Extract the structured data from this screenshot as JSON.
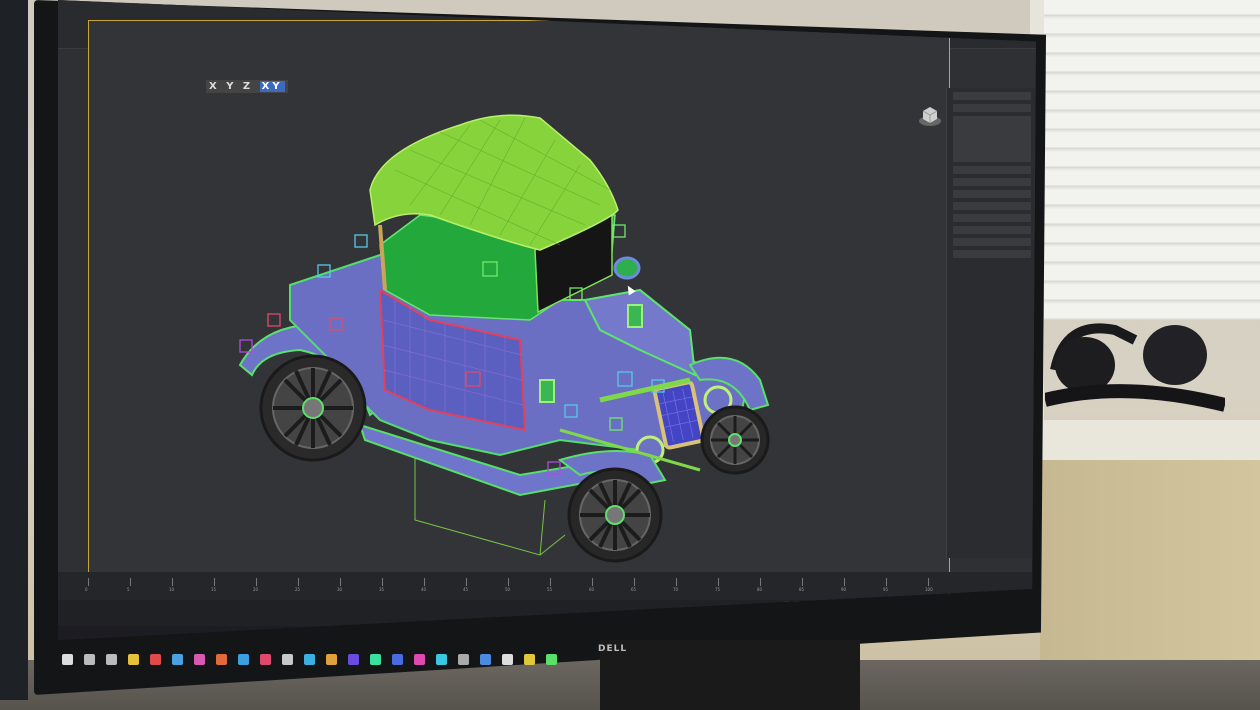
{
  "scene": {
    "description_colors": {
      "roof": "#8cd43a",
      "body": "#6b6fc4",
      "interior": "#1fae3c",
      "wire_green": "#4df06a",
      "wire_red": "#e0405a",
      "tire": "#2a2a2a"
    }
  },
  "viewport": {
    "axis_labels": "X Y Z",
    "axis_highlight": "XY"
  },
  "monitor": {
    "brand": "DELL"
  },
  "timeline": {
    "ticks": [
      "0",
      "5",
      "10",
      "15",
      "20",
      "25",
      "30",
      "35",
      "40",
      "45",
      "50",
      "55",
      "60",
      "65",
      "70",
      "75",
      "80",
      "85",
      "90",
      "95",
      "100"
    ]
  },
  "taskbar": {
    "icons": [
      "windows-icon",
      "search-icon",
      "taskview-icon",
      "file-explorer-icon",
      "app-icon",
      "app-icon",
      "app-icon",
      "app-icon",
      "app-icon",
      "app-icon",
      "app-icon",
      "app-icon",
      "app-icon",
      "app-icon",
      "app-icon",
      "app-icon",
      "app-icon",
      "app-icon",
      "app-icon",
      "app-icon",
      "app-icon",
      "app-icon",
      "app-icon"
    ]
  }
}
